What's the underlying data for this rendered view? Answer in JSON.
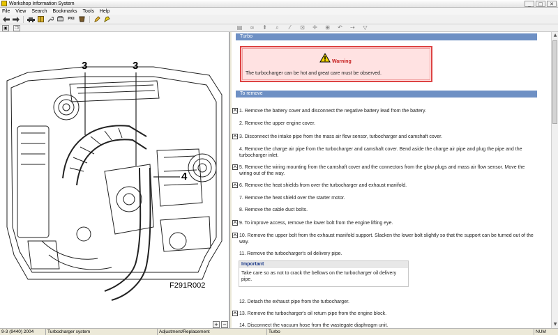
{
  "window": {
    "title": "Workshop Information System",
    "controls": [
      "_",
      "□",
      "✕"
    ]
  },
  "menu": [
    {
      "label": "File"
    },
    {
      "label": "View"
    },
    {
      "label": "Search"
    },
    {
      "label": "Bookmarks"
    },
    {
      "label": "Tools"
    },
    {
      "label": "Help"
    }
  ],
  "toolbar": {
    "icons": [
      "back-arrow-icon",
      "forward-arrow-icon",
      "car-icon",
      "book-icon",
      "wrench-icon",
      "print-preview-icon",
      "pki-icon",
      "cup-icon",
      "pencil-icon",
      "help-icon"
    ],
    "pki_label": "PKI"
  },
  "left_toolbar": {
    "buttons": [
      "print-icon",
      "copy-icon"
    ]
  },
  "right_toolbar": {
    "icons": [
      "page-icon",
      "link-icon",
      "up-icon",
      "zoom-icon",
      "pen-icon",
      "lock-icon",
      "cross-icon",
      "grid-icon",
      "undo-icon",
      "arrow-icon",
      "funnel-icon"
    ]
  },
  "figure": {
    "code": "F291R002",
    "callouts": [
      "3",
      "3",
      "4"
    ],
    "zoom_in": "+",
    "zoom_out": "−"
  },
  "content": {
    "heading": "Turbo",
    "warning": {
      "label": "Warning",
      "text": "The turbocharger can be hot and great care must be observed."
    },
    "section": "To remove",
    "steps": [
      {
        "text": "1.  Remove the battery cover and disconnect the negative battery lead from the battery.",
        "icon": true
      },
      {
        "text": "2.  Remove the upper engine cover.",
        "icon": false
      },
      {
        "text": "3.  Disconnect the intake pipe from the mass air flow sensor, turbocharger and camshaft cover.",
        "icon": true
      },
      {
        "text": "4.  Remove the charge air pipe from the turbocharger and camshaft cover. Bend aside the charge air pipe and plug the pipe and the turbocharger inlet.",
        "icon": false
      },
      {
        "text": "5.  Remove the wiring mounting from the camshaft cover and the connectors from the glow plugs and mass air flow sensor. Move the wiring out of the way.",
        "icon": true
      },
      {
        "text": "6.  Remove the heat shields from over the turbocharger and exhaust manifold.",
        "icon": true
      },
      {
        "text": "7.  Remove the heat shield over the starter motor.",
        "icon": false
      },
      {
        "text": "8.  Remove the cable duct bolts.",
        "icon": false
      },
      {
        "text": "9.  To improve access, remove the lower bolt from the engine lifting eye.",
        "icon": true
      },
      {
        "text": "10. Remove the upper bolt from the exhaust manifold support. Slacken the lower bolt slightly so that the support can be turned out of the way.",
        "icon": true
      },
      {
        "text": "11. Remove the turbocharger's oil delivery pipe.",
        "icon": false
      },
      {
        "text": "12. Detach the exhaust pipe from the turbocharger.",
        "icon": false
      },
      {
        "text": "13. Remove the turbocharger's oil return pipe from the engine block.",
        "icon": true
      },
      {
        "text": "14. Disconnect the vacuum hose from the wastegate diaphragm unit.",
        "icon": false
      }
    ],
    "important": {
      "label": "Important",
      "text": "Take care so as not to crack the bellows on the turbocharger oil delivery pipe."
    }
  },
  "status": [
    "9-3 (9440) 2004",
    "Turbocharger system",
    "Adjustment/Replacement",
    "Turbo",
    "NUM"
  ]
}
